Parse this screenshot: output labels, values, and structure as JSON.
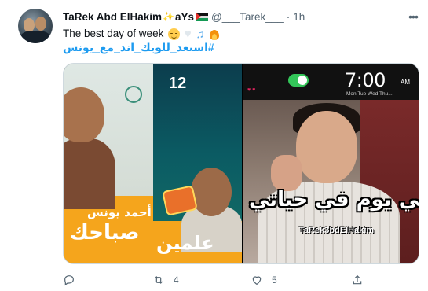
{
  "tweet": {
    "author": {
      "name": "TaRek Abd ElHakim",
      "name_suffix": "aYs",
      "handle": "@___Tarek___",
      "time": "1h"
    },
    "separator": "·",
    "text": "The best day of week",
    "hashtag": "#استعد_للويك_اند_مع_يونس",
    "media": {
      "left_image": {
        "number": "12",
        "caption_large": "صباحك",
        "caption_small": "أحمد يونس",
        "caption_right": "علمين"
      },
      "right_image": {
        "clock": "7:00",
        "ampm": "AM",
        "days": "Mon Tue Wed Thu...",
        "caption": "علي يوم في حياتي",
        "watermark": "TaRek3bdElHakim"
      }
    },
    "actions": {
      "reply_count": "",
      "retweet_count": "4",
      "like_count": "5"
    }
  },
  "colors": {
    "accent": "#1d9bf0",
    "muted": "#536471",
    "text": "#0f1419"
  }
}
